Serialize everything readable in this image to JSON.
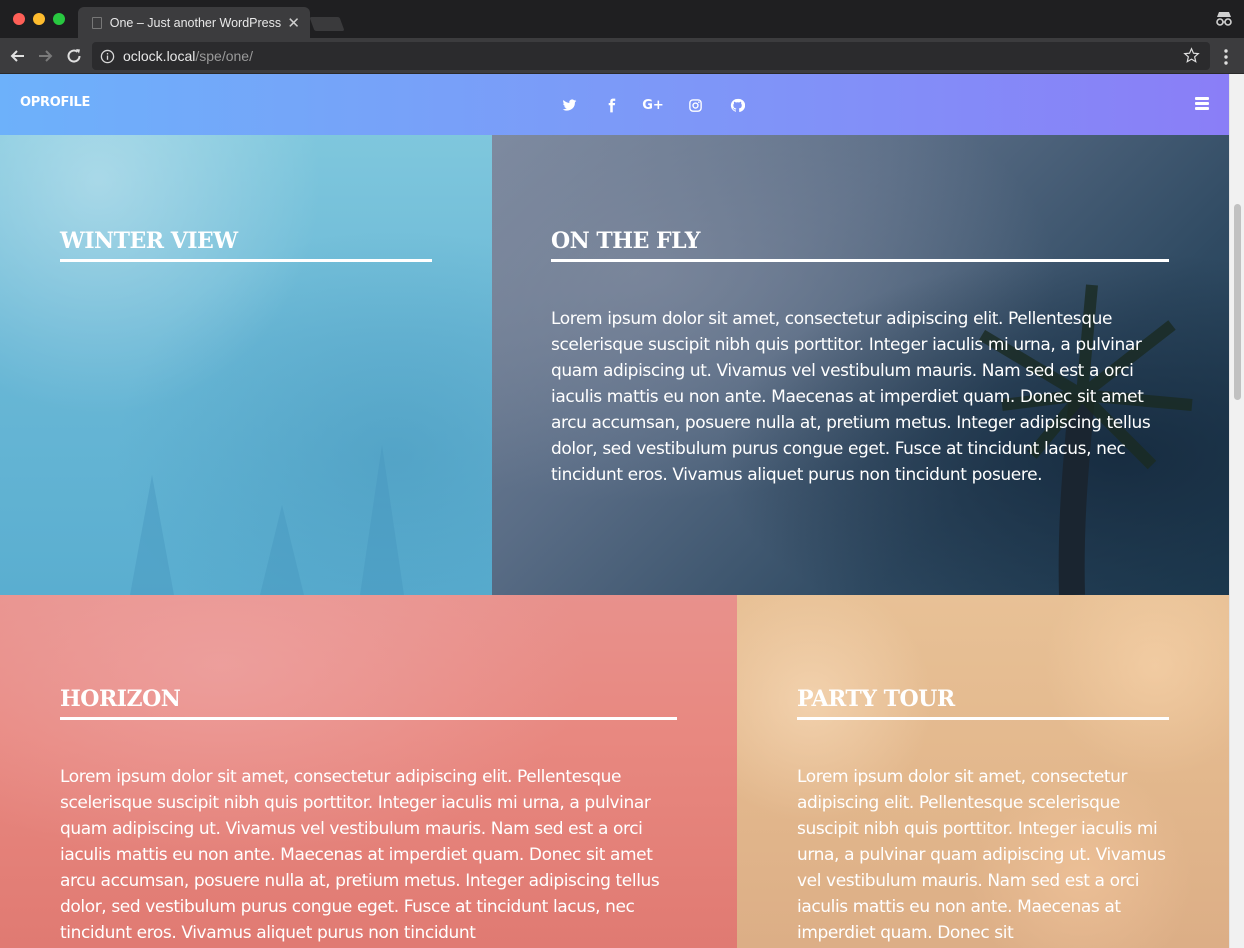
{
  "browser": {
    "tab_title": "One – Just another WordPress site",
    "url_host": "oclock.local",
    "url_path": "/spe/one/"
  },
  "site": {
    "logo": "OPROFILE",
    "socials": [
      {
        "name": "twitter-icon"
      },
      {
        "name": "facebook-icon"
      },
      {
        "name": "google-plus-icon",
        "label": "G+"
      },
      {
        "name": "instagram-icon"
      },
      {
        "name": "github-icon"
      }
    ]
  },
  "panels": {
    "winter": {
      "title": "WINTER VIEW"
    },
    "fly": {
      "title": "ON THE FLY",
      "text": "Lorem ipsum dolor sit amet, consectetur adipiscing elit. Pellentesque scelerisque suscipit nibh quis porttitor. Integer iaculis mi urna, a pulvinar quam adipiscing ut. Vivamus vel vestibulum mauris. Nam sed est a orci iaculis mattis eu non ante. Maecenas at imperdiet quam. Donec sit amet arcu accumsan, posuere nulla at, pretium metus. Integer adipiscing tellus dolor, sed vestibulum purus congue eget. Fusce at tincidunt lacus, nec tincidunt eros. Vivamus aliquet purus non tincidunt posuere."
    },
    "horizon": {
      "title": "HORIZON",
      "text": "Lorem ipsum dolor sit amet, consectetur adipiscing elit. Pellentesque scelerisque suscipit nibh quis porttitor. Integer iaculis mi urna, a pulvinar quam adipiscing ut. Vivamus vel vestibulum mauris. Nam sed est a orci iaculis mattis eu non ante. Maecenas at imperdiet quam. Donec sit amet arcu accumsan, posuere nulla at, pretium metus. Integer adipiscing tellus dolor, sed vestibulum purus congue eget. Fusce at tincidunt lacus, nec tincidunt eros. Vivamus aliquet purus non tincidunt"
    },
    "party": {
      "title": "PARTY TOUR",
      "text": "Lorem ipsum dolor sit amet, consectetur adipiscing elit. Pellentesque scelerisque suscipit nibh quis porttitor. Integer iaculis mi urna, a pulvinar quam adipiscing ut. Vivamus vel vestibulum mauris. Nam sed est a orci iaculis mattis eu non ante. Maecenas at imperdiet quam. Donec sit"
    }
  },
  "colors": {
    "header_gradient_start": "#6db1fa",
    "header_gradient_end": "#8a7ef7",
    "winter": "#6ab8d6",
    "horizon": "#e88880",
    "party": "#e3b88d"
  }
}
